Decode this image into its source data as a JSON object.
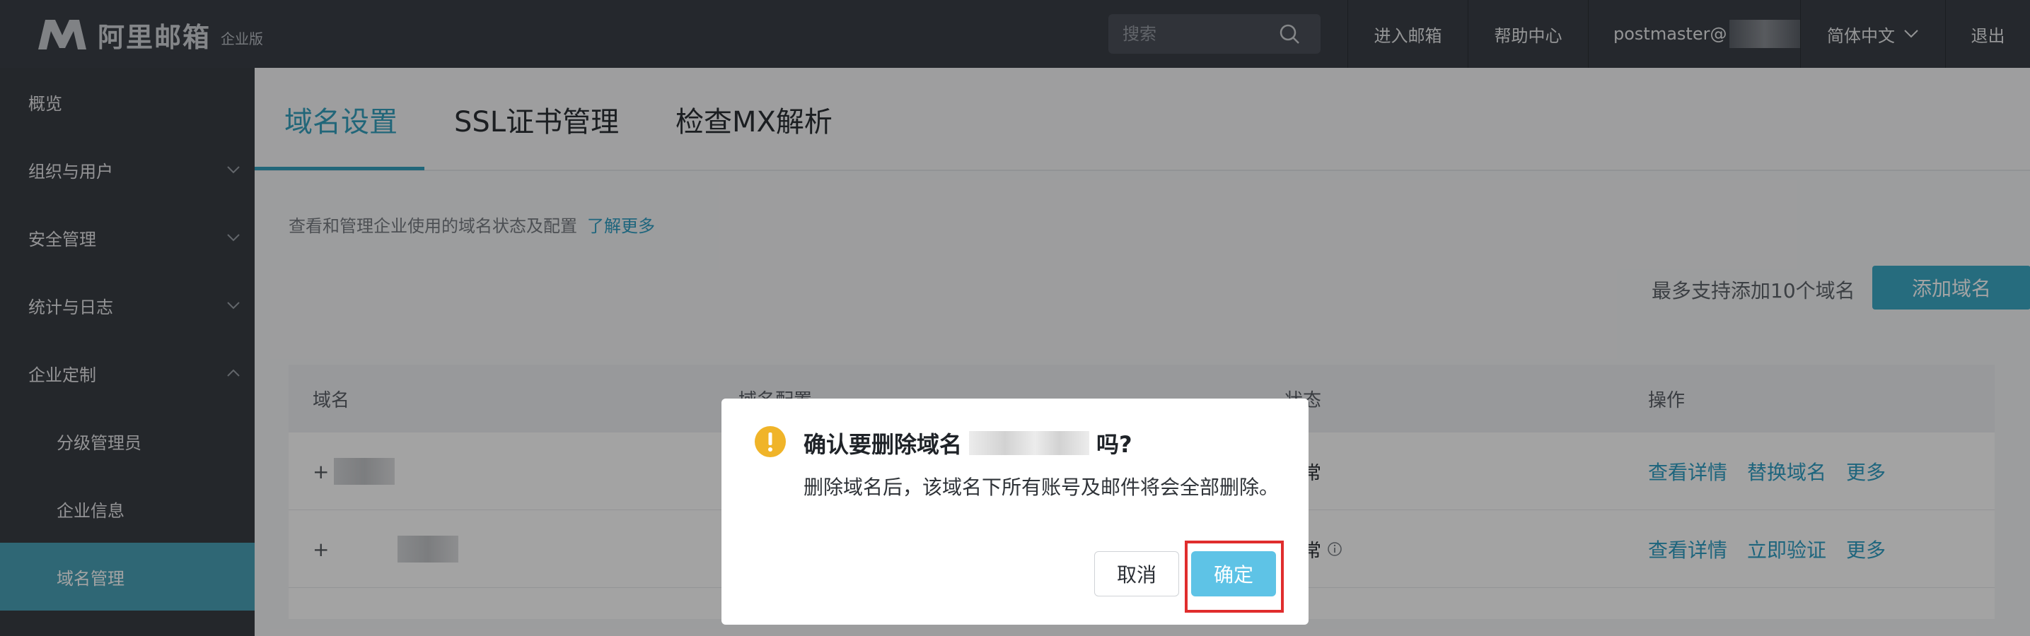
{
  "app": {
    "brand": "阿里邮箱",
    "edition": "企业版"
  },
  "topbar": {
    "search_placeholder": "搜索",
    "enter_mail": "进入邮箱",
    "help_center": "帮助中心",
    "user": "postmaster@",
    "language": "简体中文",
    "logout": "退出"
  },
  "sidebar": {
    "items": [
      {
        "label": "概览"
      },
      {
        "label": "组织与用户"
      },
      {
        "label": "安全管理"
      },
      {
        "label": "统计与日志"
      },
      {
        "label": "企业定制"
      },
      {
        "label": "分级管理员"
      },
      {
        "label": "企业信息"
      },
      {
        "label": "域名管理"
      }
    ]
  },
  "main": {
    "tabs": [
      {
        "label": "域名设置"
      },
      {
        "label": "SSL证书管理"
      },
      {
        "label": "检查MX解析"
      }
    ],
    "description": "查看和管理企业使用的域名状态及配置",
    "learn_more": "了解更多",
    "limit_text": "最多支持添加10个域名",
    "add_domain": "添加域名",
    "table": {
      "headers": [
        "域名",
        "域名配置",
        "状态",
        "操作"
      ],
      "rows": [
        {
          "status": "正常",
          "actions": [
            "查看详情",
            "替换域名",
            "更多"
          ]
        },
        {
          "status": "正常",
          "actions": [
            "查看详情",
            "立即验证",
            "更多"
          ]
        }
      ]
    }
  },
  "dialog": {
    "title_prefix": "确认要删除域名",
    "title_suffix": "吗?",
    "body": "删除域名后，该域名下所有账号及邮件将会全部删除。",
    "cancel": "取消",
    "confirm": "确定"
  },
  "colors": {
    "accent": "#35a0bd",
    "confirm_button": "#5ec3e6",
    "highlight": "#e02d2d",
    "warning": "#f0b429"
  }
}
